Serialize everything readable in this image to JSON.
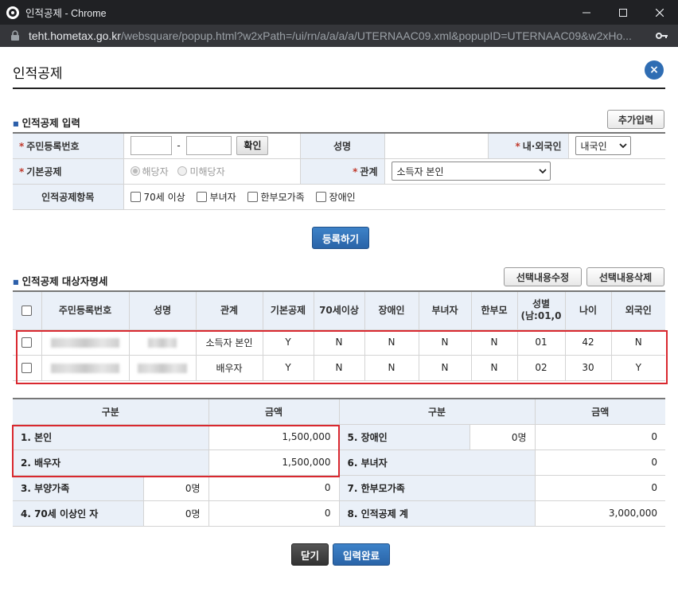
{
  "window": {
    "title": "인적공제 - Chrome",
    "url_host": "teht.hometax.go.kr",
    "url_path": "/websquare/popup.html?w2xPath=/ui/rn/a/a/a/a/UTERNAAC09.xml&popupID=UTERNAAC09&w2xHo..."
  },
  "popup": {
    "title": "인적공제",
    "close_label": "×"
  },
  "input_section": {
    "title": "인적공제 입력",
    "add_button": "추가입력",
    "rrn_label": "주민등록번호",
    "rrn_dash": "-",
    "confirm_button": "확인",
    "name_label": "성명",
    "nationality_label": "내·외국인",
    "nationality_value": "내국인",
    "basic_label": "기본공제",
    "basic_opt_yes": "해당자",
    "basic_opt_no": "미해당자",
    "relation_label": "관계",
    "relation_value": "소득자 본인",
    "items_label": "인적공제항목",
    "items": [
      "70세 이상",
      "부녀자",
      "한부모가족",
      "장애인"
    ],
    "register_button": "등록하기"
  },
  "list_section": {
    "title": "인적공제 대상자명세",
    "edit_button": "선택내용수정",
    "delete_button": "선택내용삭제",
    "headers": [
      "주민등록번호",
      "성명",
      "관계",
      "기본공제",
      "70세이상",
      "장애인",
      "부녀자",
      "한부모",
      "성별\n(남:01,0",
      "나이",
      "외국인"
    ],
    "header_gender_1": "성별",
    "header_gender_2": "(남:01,0",
    "rows": [
      {
        "relation": "소득자 본인",
        "basic": "Y",
        "over70": "N",
        "disabled": "N",
        "woman": "N",
        "single": "N",
        "gender": "01",
        "age": "42",
        "foreign": "N"
      },
      {
        "relation": "배우자",
        "basic": "Y",
        "over70": "N",
        "disabled": "N",
        "woman": "N",
        "single": "N",
        "gender": "02",
        "age": "30",
        "foreign": "Y"
      }
    ]
  },
  "summary": {
    "h_category": "구분",
    "h_amount": "금액",
    "r1_label": "1. 본인",
    "r1_amount": "1,500,000",
    "r2_label": "2. 배우자",
    "r2_amount": "1,500,000",
    "r3_label": "3. 부양가족",
    "r3_count": "0명",
    "r3_amount": "0",
    "r4_label": "4. 70세 이상인 자",
    "r4_count": "0명",
    "r4_amount": "0",
    "r5_label": "5. 장애인",
    "r5_count": "0명",
    "r5_amount": "0",
    "r6_label": "6. 부녀자",
    "r6_amount": "0",
    "r7_label": "7. 한부모가족",
    "r7_amount": "0",
    "r8_label": "8. 인적공제 계",
    "r8_amount": "3,000,000"
  },
  "footer": {
    "close_button": "닫기",
    "complete_button": "입력완료"
  },
  "colors": {
    "accent_blue": "#2f6db3",
    "header_bg": "#eaf0f8",
    "highlight_red": "#d9282f"
  }
}
